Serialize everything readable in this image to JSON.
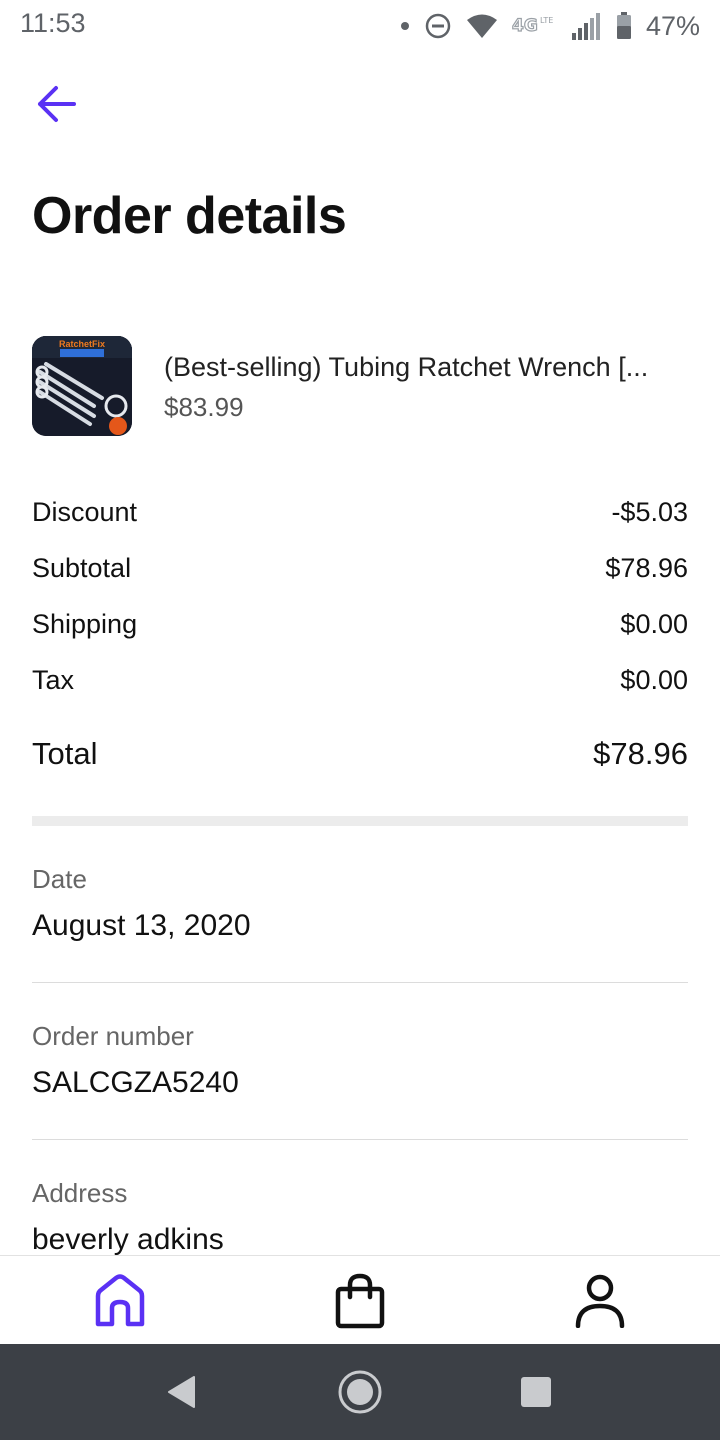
{
  "status_bar": {
    "time": "11:53",
    "battery": "47%",
    "icons": [
      "dot-icon",
      "do-not-disturb-icon",
      "wifi-icon",
      "lte-icon",
      "signal-icon",
      "battery-icon"
    ]
  },
  "header": {
    "back_icon": "back-arrow-icon",
    "title": "Order details"
  },
  "product": {
    "image_label": "RatchetFix TUBING WRENCH",
    "title": "(Best-selling) Tubing Ratchet Wrench [...",
    "price": "$83.99"
  },
  "summary": {
    "rows": [
      {
        "label": "Discount",
        "value": "-$5.03"
      },
      {
        "label": "Subtotal",
        "value": "$78.96"
      },
      {
        "label": "Shipping",
        "value": "$0.00"
      },
      {
        "label": "Tax",
        "value": "$0.00"
      }
    ],
    "total_label": "Total",
    "total_value": "$78.96"
  },
  "details": {
    "date_label": "Date",
    "date_value": "August 13, 2020",
    "order_label": "Order number",
    "order_value": "SALCGZA5240",
    "address_label": "Address",
    "address_value": "beverly adkins"
  },
  "tab_bar": {
    "items": [
      {
        "name": "home",
        "icon": "home-icon",
        "active": true
      },
      {
        "name": "orders",
        "icon": "shopping-bag-icon",
        "active": false
      },
      {
        "name": "account",
        "icon": "profile-icon",
        "active": false
      }
    ]
  },
  "android_nav": [
    "back-triangle-icon",
    "home-circle-icon",
    "recents-square-icon"
  ],
  "colors": {
    "accent": "#5a31f4",
    "text": "#111111",
    "muted": "#666666",
    "nav_bg": "#3c4046"
  }
}
